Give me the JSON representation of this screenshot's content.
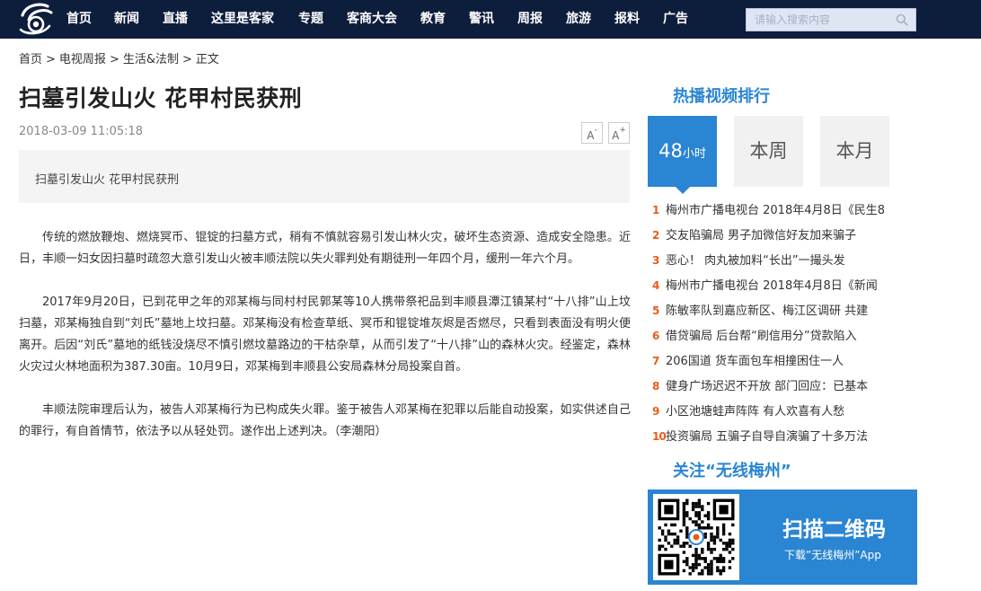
{
  "nav": {
    "items": [
      "首页",
      "新闻",
      "直播",
      "这里是客家",
      "专题",
      "客商大会",
      "教育",
      "警讯",
      "周报",
      "旅游",
      "报料",
      "广告"
    ],
    "search_placeholder": "请输入搜索内容"
  },
  "breadcrumb": [
    "首页",
    "电视周报",
    "生活&法制",
    "正文"
  ],
  "article": {
    "title": "扫墓引发山火 花甲村民获刑",
    "time": "2018-03-09 11:05:18",
    "font_decrease": "A",
    "font_decrease_sup": "-",
    "font_increase": "A",
    "font_increase_sup": "+",
    "summary": "扫墓引发山火 花甲村民获刑",
    "paragraphs": [
      "传统的燃放鞭炮、燃烧冥币、锟锭的扫墓方式，稍有不慎就容易引发山林火灾，破坏生态资源、造成安全隐患。近日，丰顺一妇女因扫墓时疏忽大意引发山火被丰顺法院以失火罪判处有期徒刑一年四个月，缓刑一年六个月。",
      "2017年9月20日，已到花甲之年的邓某梅与同村村民郭某等10人携带祭祀品到丰顺县潭江镇某村“十八排”山上坟扫墓，邓某梅独自到“刘氏”墓地上坟扫墓。邓某梅没有检查草纸、冥币和锟锭堆灰烬是否燃尽，只看到表面没有明火便离开。后因“刘氏”墓地的纸钱没烧尽不慎引燃坟墓路边的干枯杂草，从而引发了“十八排”山的森林火灾。经鉴定，森林火灾过火林地面积为387.30亩。10月9日，邓某梅到丰顺县公安局森林分局投案自首。",
      "丰顺法院审理后认为，被告人邓某梅行为已构成失火罪。鉴于被告人邓某梅在犯罪以后能自动投案，如实供述自己的罪行，有自首情节，依法予以从轻处罚。遂作出上述判决。（李潮阳）"
    ]
  },
  "sidebar": {
    "hot_title": "热播视频排行",
    "tabs": [
      {
        "big": "48",
        "small": "小时"
      },
      {
        "big": "本周",
        "small": ""
      },
      {
        "big": "本月",
        "small": ""
      }
    ],
    "ranking": [
      {
        "num": "1",
        "text": "梅州市广播电视台 2018年4月8日《民生8"
      },
      {
        "num": "2",
        "text": "交友陷骗局 男子加微信好友加来骗子"
      },
      {
        "num": "3",
        "text": "恶心！ 肉丸被加料“长出”一撮头发"
      },
      {
        "num": "4",
        "text": "梅州市广播电视台 2018年4月8日《新闻"
      },
      {
        "num": "5",
        "text": "陈敏率队到嘉应新区、梅江区调研 共建"
      },
      {
        "num": "6",
        "text": "借贷骗局 后台帮“刷信用分”贷款陷入"
      },
      {
        "num": "7",
        "text": "206国道 货车面包车相撞困住一人"
      },
      {
        "num": "8",
        "text": "健身广场迟迟不开放 部门回应：已基本"
      },
      {
        "num": "9",
        "text": "小区池塘蛙声阵阵 有人欢喜有人愁"
      },
      {
        "num": "10",
        "text": "投资骗局 五骗子自导自演骗了十多万法"
      }
    ],
    "follow_title": "关注“无线梅州”",
    "qr_heading": "扫描二维码",
    "qr_sub": "下载”无线梅州”App"
  },
  "colors": {
    "nav_bg": "#0d1d3c",
    "accent": "#2a85d3",
    "rank_num": "#e95b1a"
  }
}
